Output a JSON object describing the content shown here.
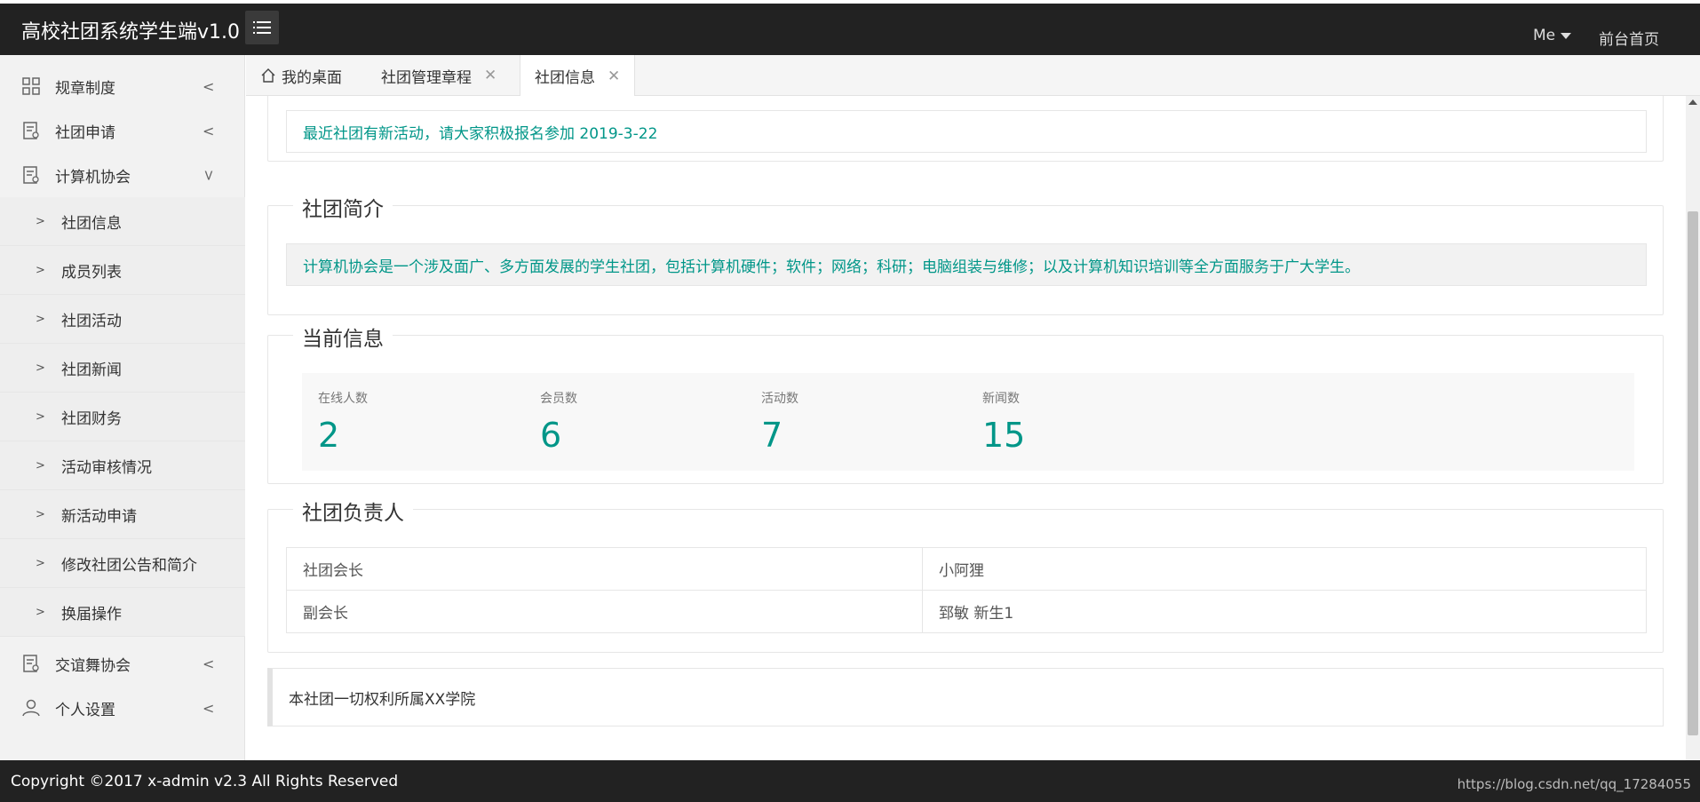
{
  "header": {
    "logo": "高校社团系统学生端v1.0",
    "user_menu": "Me",
    "home_link": "前台首页"
  },
  "sidebar": {
    "items": [
      {
        "label": "规章制度",
        "icon": "grid-icon",
        "expanded": false
      },
      {
        "label": "社团申请",
        "icon": "form-icon",
        "expanded": false
      },
      {
        "label": "计算机协会",
        "icon": "form-icon",
        "expanded": true
      },
      {
        "label": "交谊舞协会",
        "icon": "form-icon",
        "expanded": false
      },
      {
        "label": "个人设置",
        "icon": "user-icon",
        "expanded": false
      }
    ],
    "subitems": [
      {
        "label": "社团信息"
      },
      {
        "label": "成员列表"
      },
      {
        "label": "社团活动"
      },
      {
        "label": "社团新闻"
      },
      {
        "label": "社团财务"
      },
      {
        "label": "活动审核情况"
      },
      {
        "label": "新活动申请"
      },
      {
        "label": "修改社团公告和简介"
      },
      {
        "label": "换届操作"
      }
    ]
  },
  "tabs": [
    {
      "label": "我的桌面"
    },
    {
      "label": "社团管理章程"
    },
    {
      "label": "社团信息"
    }
  ],
  "notice": {
    "text": "最近社团有新活动，请大家积极报名参加 2019-3-22"
  },
  "intro": {
    "title": "社团简介",
    "text": "计算机协会是一个涉及面广、多方面发展的学生社团，包括计算机硬件；软件；网络；科研；电脑组装与维修；以及计算机知识培训等全方面服务于广大学生。"
  },
  "current_info": {
    "title": "当前信息",
    "stats": [
      {
        "label": "在线人数",
        "value": "2"
      },
      {
        "label": "会员数",
        "value": "6"
      },
      {
        "label": "活动数",
        "value": "7"
      },
      {
        "label": "新闻数",
        "value": "15"
      }
    ]
  },
  "leaders": {
    "title": "社团负责人",
    "rows": [
      {
        "role": "社团会长",
        "name": "小阿狸"
      },
      {
        "role": "副会长",
        "name": "郅敏 新生1"
      }
    ]
  },
  "copyright_note": "本社团一切权利所属XX学院",
  "footer": {
    "copyright": "Copyright ©2017 x-admin v2.3 All Rights Reserved",
    "url": "https://blog.csdn.net/qq_17284055"
  },
  "colors": {
    "accent": "#009688",
    "header_bg": "#222222",
    "sidebar_bg": "#f2f2f2"
  }
}
